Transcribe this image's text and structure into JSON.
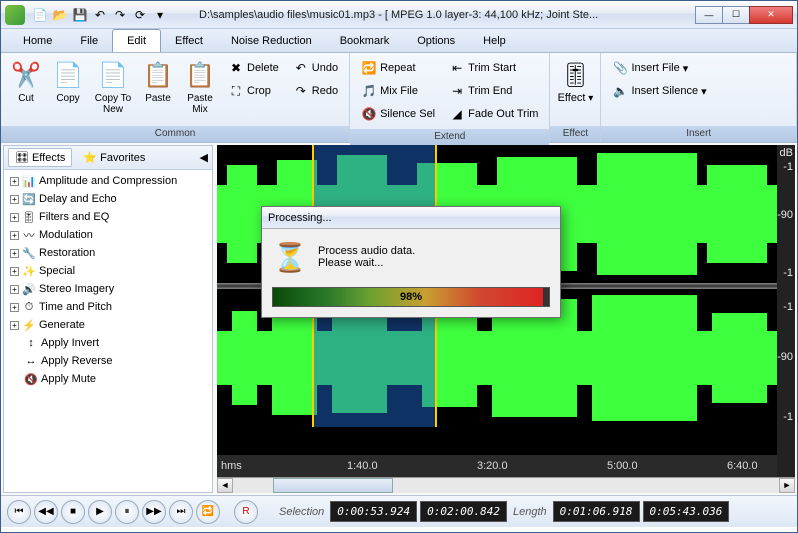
{
  "title": "D:\\samples\\audio files\\music01.mp3 - [ MPEG 1.0 layer-3: 44,100 kHz; Joint Ste...",
  "menu": {
    "home": "Home",
    "file": "File",
    "edit": "Edit",
    "effect": "Effect",
    "noise": "Noise Reduction",
    "bookmark": "Bookmark",
    "options": "Options",
    "help": "Help"
  },
  "ribbon": {
    "common": {
      "label": "Common",
      "cut": "Cut",
      "copy": "Copy",
      "copynew": "Copy\nTo New",
      "paste": "Paste",
      "pastemix": "Paste\nMix",
      "delete": "Delete",
      "crop": "Crop",
      "undo": "Undo",
      "redo": "Redo"
    },
    "extend": {
      "label": "Extend",
      "repeat": "Repeat",
      "mix": "Mix File",
      "silence": "Silence Sel",
      "trimstart": "Trim Start",
      "trimend": "Trim End",
      "fadeout": "Fade Out Trim"
    },
    "effect": {
      "label": "Effect",
      "effect": "Effect"
    },
    "insert": {
      "label": "Insert",
      "file": "Insert File",
      "silence": "Insert Silence"
    }
  },
  "sidebar": {
    "tab_effects": "Effects",
    "tab_favorites": "Favorites",
    "items": [
      {
        "label": "Amplitude and Compression"
      },
      {
        "label": "Delay and Echo"
      },
      {
        "label": "Filters and EQ"
      },
      {
        "label": "Modulation"
      },
      {
        "label": "Restoration"
      },
      {
        "label": "Special"
      },
      {
        "label": "Stereo Imagery"
      },
      {
        "label": "Time and Pitch"
      },
      {
        "label": "Generate"
      },
      {
        "label": "Apply Invert"
      },
      {
        "label": "Apply Reverse"
      },
      {
        "label": "Apply Mute"
      }
    ]
  },
  "dialog": {
    "title": "Processing...",
    "line1": "Process audio data.",
    "line2": "Please wait...",
    "progress": "98%"
  },
  "db": {
    "label": "dB",
    "m1": "-1",
    "m90": "-90"
  },
  "timeline": {
    "hms": "hms",
    "t1": "1:40.0",
    "t2": "3:20.0",
    "t3": "5:00.0",
    "t4": "6:40.0"
  },
  "status": {
    "selection": "Selection",
    "length": "Length",
    "s1": "0:00:53.924",
    "s2": "0:02:00.842",
    "l1": "0:01:06.918",
    "l2": "0:05:43.036"
  }
}
